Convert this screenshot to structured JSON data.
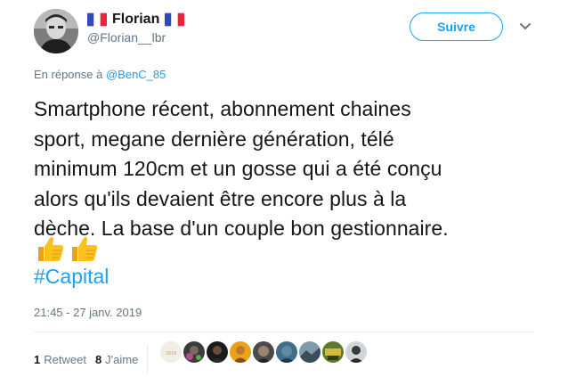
{
  "user": {
    "display_name": "Florian",
    "handle": "@Florian__lbr",
    "avatar_icon": "profile-photo-bw",
    "flag_icon": "france-flag"
  },
  "follow_button": {
    "label": "Suivre"
  },
  "reply": {
    "prefix": "En réponse à",
    "mention": "@BenC_85"
  },
  "tweet": {
    "lines": [
      "Smartphone récent, abonnement chaines",
      "sport, megane dernière génération, télé",
      "minimum 120cm et un gosse qui a été conçu",
      "alors qu'ils devaient être encore plus à la",
      "dèche. La base d'un couple bon gestionnaire."
    ],
    "emoji": [
      "thumbs-up-icon",
      "thumbs-up-icon"
    ],
    "hashtag": "#Capital"
  },
  "timestamp": "21:45 - 27 janv. 2019",
  "stats": {
    "retweets_count": "1",
    "retweets_label": "Retweet",
    "likes_count": "8",
    "likes_label": "J'aime"
  },
  "likers": {
    "first_badge": "2019",
    "avatars": [
      "liker-avatar-1",
      "liker-avatar-2",
      "liker-avatar-3",
      "liker-avatar-4",
      "liker-avatar-5",
      "liker-avatar-6",
      "liker-avatar-7",
      "liker-avatar-8",
      "liker-avatar-9"
    ]
  },
  "colors": {
    "accent": "#1da1f2",
    "text": "#14171a",
    "muted": "#657786",
    "divider": "#e6ecf0"
  }
}
